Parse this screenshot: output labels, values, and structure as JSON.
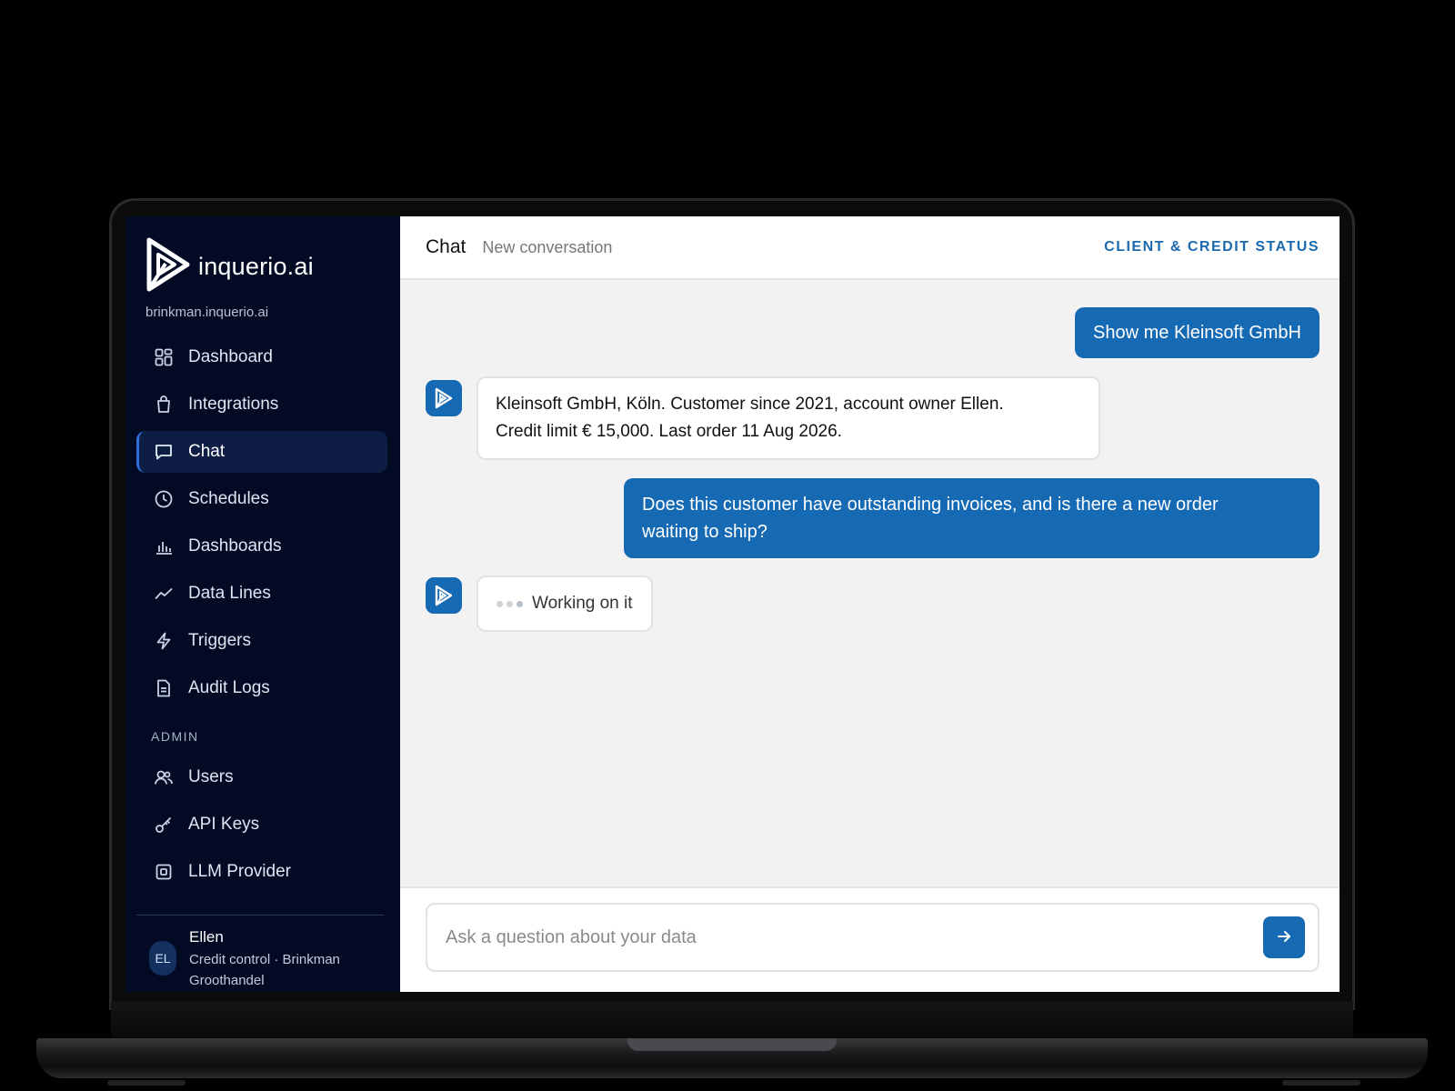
{
  "app": {
    "brand": "inquerio.ai",
    "workspace": "brinkman.inquerio.ai"
  },
  "sidebar": {
    "items": [
      {
        "label": "Dashboard",
        "icon": "grid-icon"
      },
      {
        "label": "Integrations",
        "icon": "bag-icon"
      },
      {
        "label": "Chat",
        "icon": "chat-bubble-icon",
        "active": true
      },
      {
        "label": "Schedules",
        "icon": "clock-icon"
      },
      {
        "label": "Dashboards",
        "icon": "bar-chart-icon"
      },
      {
        "label": "Data Lines",
        "icon": "trend-line-icon"
      },
      {
        "label": "Triggers",
        "icon": "lightning-icon"
      },
      {
        "label": "Audit Logs",
        "icon": "document-icon"
      }
    ],
    "admin_label": "ADMIN",
    "admin_items": [
      {
        "label": "Users",
        "icon": "users-icon"
      },
      {
        "label": "API Keys",
        "icon": "key-icon"
      },
      {
        "label": "LLM Provider",
        "icon": "chip-icon"
      }
    ],
    "user": {
      "initials": "EL",
      "name": "Ellen",
      "role_line1": "Credit control · Brinkman",
      "role_line2": "Groothandel"
    }
  },
  "header": {
    "title": "Chat",
    "subtitle": "New conversation",
    "link": "CLIENT & CREDIT STATUS"
  },
  "messages": [
    {
      "role": "user",
      "text": "Show me Kleinsoft GmbH"
    },
    {
      "role": "bot",
      "line1": "Kleinsoft GmbH, Köln. Customer since 2021, account owner Ellen.",
      "line2": "Credit limit € 15,000. Last order 11 Aug 2026."
    },
    {
      "role": "user",
      "line1": "Does this customer have outstanding invoices, and is there a new order",
      "line2": "waiting to ship?"
    },
    {
      "role": "bot",
      "status": "Working on it"
    }
  ],
  "composer": {
    "placeholder": "Ask a question about your data",
    "send_icon": "arrow-right-icon"
  },
  "colors": {
    "sidebar_bg": "#020a24",
    "accent": "#1669b3",
    "main_bg": "#f2f2f2"
  }
}
